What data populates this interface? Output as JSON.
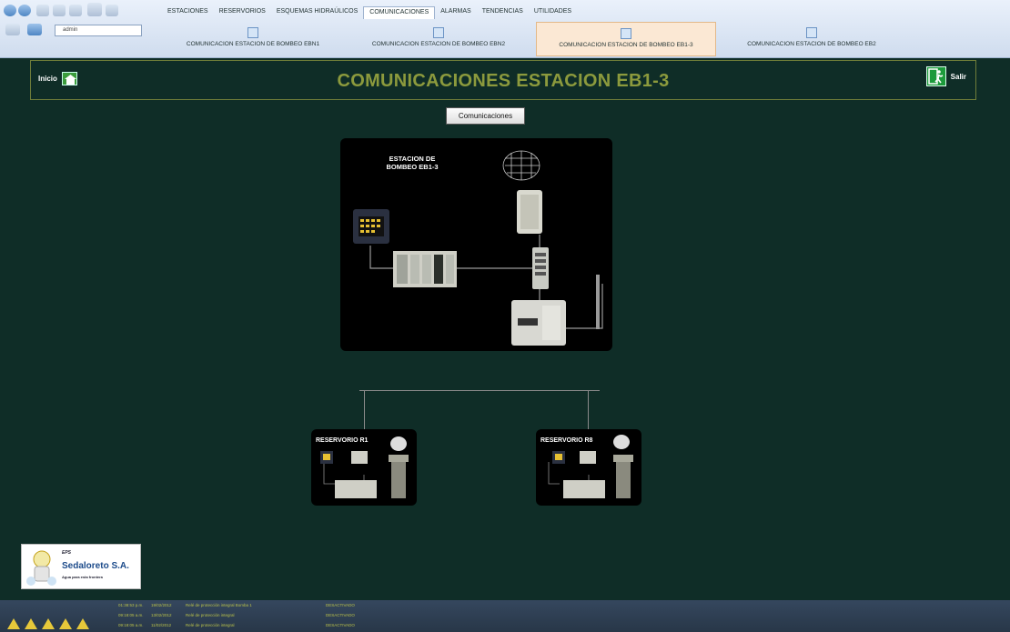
{
  "ribbon": {
    "user": "admin",
    "main_tabs": [
      {
        "label": "ESTACIONES",
        "active": false
      },
      {
        "label": "RESERVORIOS",
        "active": false
      },
      {
        "label": "ESQUEMAS HIDRAÚLICOS",
        "active": false
      },
      {
        "label": "COMUNICACIONES",
        "active": true
      },
      {
        "label": "ALARMAS",
        "active": false
      },
      {
        "label": "TENDENCIAS",
        "active": false
      },
      {
        "label": "UTILIDADES",
        "active": false
      }
    ],
    "sub_tabs": [
      {
        "label": "COMUNICACION ESTACION DE BOMBEO EBN1",
        "active": false
      },
      {
        "label": "COMUNICACION ESTACION DE BOMBEO EBN2",
        "active": false
      },
      {
        "label": "COMUNICACION ESTACION DE BOMBEO EB1-3",
        "active": true
      },
      {
        "label": "COMUNICACION ESTACION DE BOMBEO EB2",
        "active": false
      }
    ]
  },
  "header": {
    "home_label": "Inicio",
    "title": "COMUNICACIONES ESTACION EB1-3",
    "exit_label": "Salir"
  },
  "comm_button_label": "Comunicaciones",
  "station": {
    "label_line1": "ESTACION DE",
    "label_line2": "BOMBEO EB1-3"
  },
  "reservoirs": [
    {
      "label": "RESERVORIO R1"
    },
    {
      "label": "RESERVORIO R8"
    }
  ],
  "logo": {
    "eps": "EPS",
    "name": "Sedaloreto S.A.",
    "tagline": "Agua para esta frontera"
  },
  "alarms": [
    {
      "time": "01:38:53 p.m.",
      "date": "19/02/2012",
      "message": "Relé de protección integral Bomba 1",
      "status": "DESACTIVADO"
    },
    {
      "time": "09:18:05 a.m.",
      "date": "13/02/2012",
      "message": "Relé de protección integral",
      "status": "DESACTIVADO"
    },
    {
      "time": "09:18:05 a.m.",
      "date": "11/02/2012",
      "message": "Relé de protección integral",
      "status": "DESACTIVADO"
    }
  ],
  "colors": {
    "background": "#0f2d27",
    "title": "#8c9a3d",
    "header_border": "#6f7d39",
    "alarm_text": "#b9c14a"
  }
}
